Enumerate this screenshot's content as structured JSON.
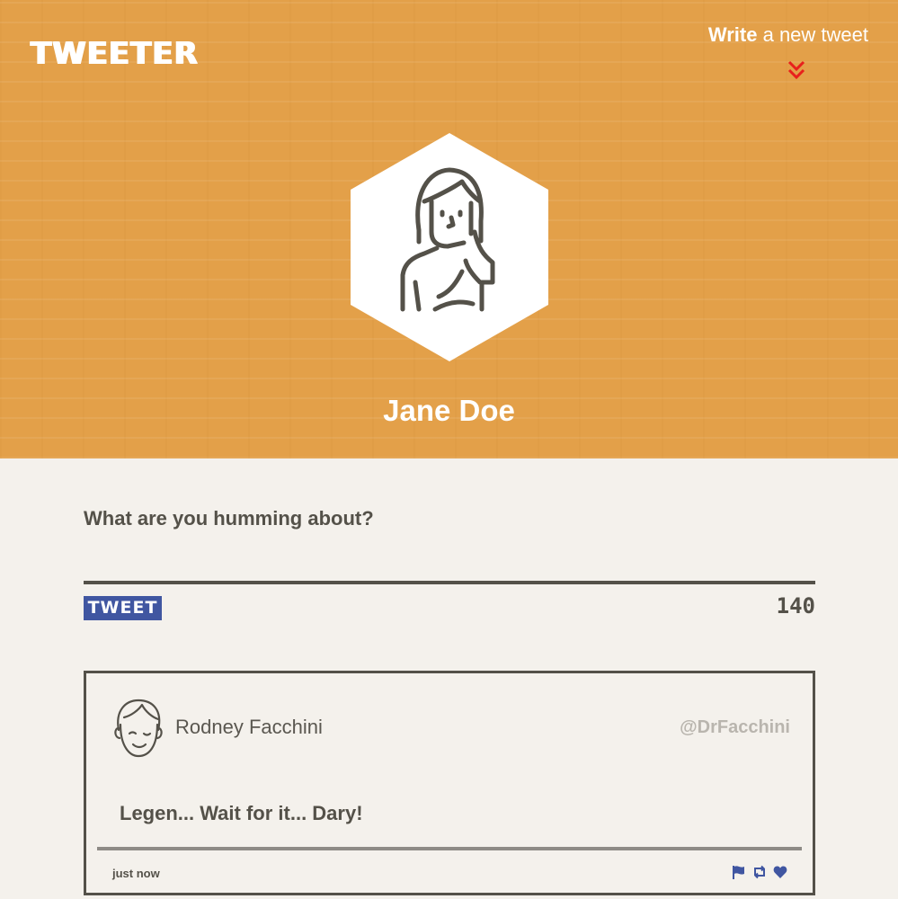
{
  "nav": {
    "logo": "TWEETER",
    "compose_bold": "Write",
    "compose_rest": " a new tweet",
    "compose_icon": "double-chevron-down-icon",
    "compose_icon_color": "#e8201c"
  },
  "profile": {
    "name": "Jane Doe",
    "avatar_icon": "woman-avatar-icon"
  },
  "compose": {
    "prompt": "What are you humming about?",
    "button_label": "TWEET",
    "char_count": "140"
  },
  "tweets": [
    {
      "author": "Rodney Facchini",
      "handle": "@DrFacchini",
      "body": "Legen... Wait for it... Dary!",
      "time": "just now",
      "avatar_icon": "man-avatar-icon",
      "actions": [
        "flag-icon",
        "retweet-icon",
        "heart-icon"
      ]
    }
  ],
  "colors": {
    "header_bg": "#e3a049",
    "page_bg": "#f4f1ec",
    "text": "#545149",
    "accent": "#4056a1"
  }
}
